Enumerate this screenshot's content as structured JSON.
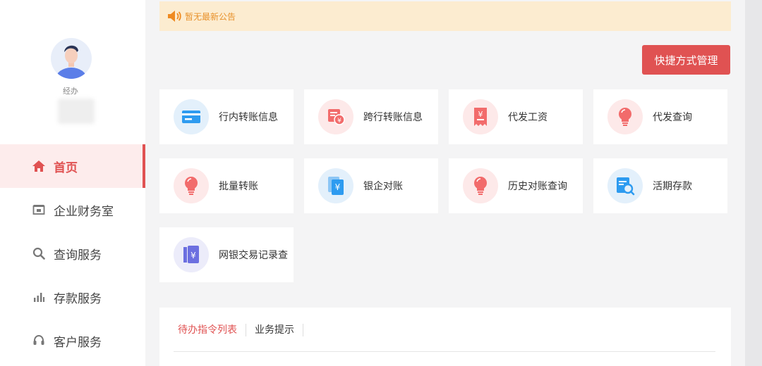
{
  "user": {
    "role": "经办"
  },
  "nav": {
    "items": [
      {
        "label": "首页",
        "icon": "home-icon",
        "active": true
      },
      {
        "label": "企业财务室",
        "icon": "finance-office-icon",
        "active": false
      },
      {
        "label": "查询服务",
        "icon": "search-icon",
        "active": false
      },
      {
        "label": "存款服务",
        "icon": "bar-chart-icon",
        "active": false
      },
      {
        "label": "客户服务",
        "icon": "headset-icon",
        "active": false
      }
    ]
  },
  "notice": {
    "text": "暂无最新公告",
    "icon": "speaker-icon"
  },
  "shortcut_button": {
    "label": "快捷方式管理"
  },
  "shortcuts": [
    {
      "label": "行内转账信息",
      "icon": "card-transfer-icon",
      "color": "blue"
    },
    {
      "label": "跨行转账信息",
      "icon": "interbank-transfer-icon",
      "color": "red"
    },
    {
      "label": "代发工资",
      "icon": "payroll-icon",
      "color": "red"
    },
    {
      "label": "代发查询",
      "icon": "bulb-icon",
      "color": "red"
    },
    {
      "label": "批量转账",
      "icon": "bulb-icon",
      "color": "red"
    },
    {
      "label": "银企对账",
      "icon": "reconcile-icon",
      "color": "blue"
    },
    {
      "label": "历史对账查询",
      "icon": "bulb-icon",
      "color": "red"
    },
    {
      "label": "活期存款",
      "icon": "deposit-search-icon",
      "color": "blue"
    },
    {
      "label": "网银交易记录查",
      "icon": "transaction-record-icon",
      "color": "purple"
    }
  ],
  "panel": {
    "tabs": [
      {
        "label": "待办指令列表",
        "active": true
      },
      {
        "label": "业务提示",
        "active": false
      }
    ]
  },
  "colors": {
    "accent": "#e05252",
    "notice_bg": "#fcecd0",
    "notice_text": "#e8922c",
    "blue": "#2d9bf0",
    "red": "#f26b6b",
    "purple": "#6c6fe0"
  }
}
